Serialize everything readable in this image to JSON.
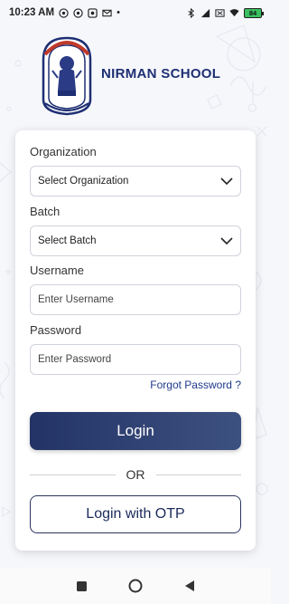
{
  "status_bar": {
    "time": "10:23 AM",
    "icons_left": [
      "whatsapp-icon",
      "whatsapp-icon",
      "message-icon",
      "mail-icon"
    ],
    "icons_right": [
      "bluetooth-icon",
      "signal-icon",
      "wifi-off-icon",
      "wifi-icon"
    ],
    "battery": "84"
  },
  "header": {
    "school_name": "NIRMAN SCHOOL",
    "logo": "school-emblem"
  },
  "form": {
    "organization_label": "Organization",
    "organization_value": "Select Organization",
    "batch_label": "Batch",
    "batch_value": "Select Batch",
    "username_label": "Username",
    "username_placeholder": "Enter Username",
    "password_label": "Password",
    "password_placeholder": "Enter Password",
    "forgot_password": "Forgot Password ?",
    "login_button": "Login",
    "or_text": "OR",
    "otp_button": "Login with OTP"
  },
  "colors": {
    "primary": "#233366",
    "school_name": "#1e2f73",
    "link": "#1e3a8a"
  },
  "nav_bar": [
    "recent-apps-icon",
    "home-icon",
    "back-icon"
  ]
}
